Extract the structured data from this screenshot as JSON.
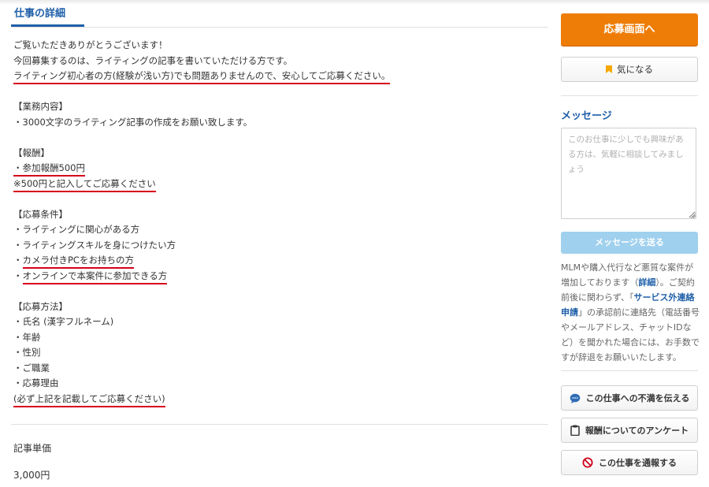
{
  "main": {
    "tab_title": "仕事の詳細",
    "lines": [
      {
        "parts": [
          {
            "t": "ご覧いただきありがとうございます！"
          }
        ]
      },
      {
        "parts": [
          {
            "t": "今回募集するのは、ライティングの記事を書いていただける方です。"
          }
        ]
      },
      {
        "parts": [
          {
            "t": "ライティング初心者の方(経験が浅い方)でも問題ありませんので、安心してご応募ください。",
            "u": true
          }
        ]
      },
      {
        "parts": []
      },
      {
        "parts": [
          {
            "t": "【業務内容】"
          }
        ]
      },
      {
        "parts": [
          {
            "t": "・3000文字のライティング記事の作成をお願い致します。"
          }
        ]
      },
      {
        "parts": []
      },
      {
        "parts": [
          {
            "t": "【報酬】"
          }
        ]
      },
      {
        "parts": [
          {
            "t": "・参加報酬500円",
            "u": true
          }
        ]
      },
      {
        "parts": [
          {
            "t": "※500円と記入してご応募ください",
            "u": true
          }
        ]
      },
      {
        "parts": []
      },
      {
        "parts": [
          {
            "t": "【応募条件】"
          }
        ]
      },
      {
        "parts": [
          {
            "t": "・ライティングに関心がある方"
          }
        ]
      },
      {
        "parts": [
          {
            "t": "・ライティングスキルを身につけたい方"
          }
        ]
      },
      {
        "parts": [
          {
            "t": "・"
          },
          {
            "t": "カメラ付きPCをお持ちの方",
            "u": true
          }
        ]
      },
      {
        "parts": [
          {
            "t": "・"
          },
          {
            "t": "オンラインで本案件に参加できる方",
            "u": true
          }
        ]
      },
      {
        "parts": []
      },
      {
        "parts": [
          {
            "t": "【応募方法】"
          }
        ]
      },
      {
        "parts": [
          {
            "t": "・氏名 (漢字フルネーム)"
          }
        ]
      },
      {
        "parts": [
          {
            "t": "・年齢"
          }
        ]
      },
      {
        "parts": [
          {
            "t": "・性別"
          }
        ]
      },
      {
        "parts": [
          {
            "t": "・ご職業"
          }
        ]
      },
      {
        "parts": [
          {
            "t": "・応募理由"
          }
        ]
      },
      {
        "parts": [
          {
            "t": "(必ず上記を記載してご応募ください)",
            "u": true
          }
        ]
      }
    ],
    "unit_price_label": "記事単価",
    "unit_price_value": "3,000円"
  },
  "sidebar": {
    "apply_label": "応募画面へ",
    "favorite_label": "気になる",
    "message_title": "メッセージ",
    "message_placeholder": "このお仕事に少しでも興味がある方は、気軽に相談してみましょう",
    "send_label": "メッセージを送る",
    "notice": {
      "p1": "MLMや購入代行など悪質な案件が増加しております（",
      "link1": "詳細",
      "p2": "）。ご契約前後に関わらず、「",
      "link2": "サービス外連絡申請",
      "p3": "」の承認前に連絡先（電話番号やメールアドレス、チャットIDなど）を聞かれた場合には、お手数ですが辞退をお願いいたします。"
    },
    "complaint_label": "この仕事への不満を伝える",
    "survey_label": "報酬についてのアンケート",
    "report_label": "この仕事を通報する"
  },
  "colors": {
    "accent_blue": "#1f5fa8",
    "apply_orange": "#ee7d07",
    "underline_red": "#d6001c",
    "send_light_blue": "#9fd0ee"
  },
  "icons": [
    "bookmark-icon",
    "speech-bubble-icon",
    "clipboard-icon",
    "prohibited-icon"
  ]
}
